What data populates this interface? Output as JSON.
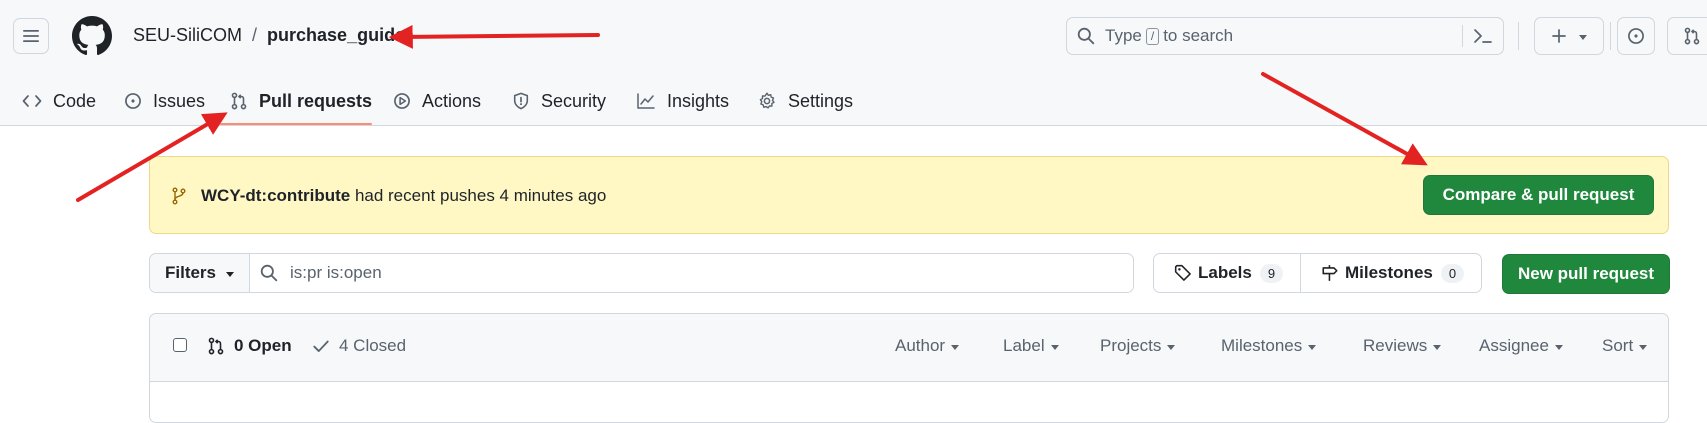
{
  "header": {
    "owner": "SEU-SiliCOM",
    "separator": "/",
    "repo": "purchase_guide",
    "search": {
      "prefix": "Type",
      "key": "/",
      "suffix": "to search"
    }
  },
  "tabs": [
    {
      "label": "Code",
      "icon": "code-icon"
    },
    {
      "label": "Issues",
      "icon": "issue-opened-icon"
    },
    {
      "label": "Pull requests",
      "icon": "git-pull-request-icon",
      "active": true
    },
    {
      "label": "Actions",
      "icon": "play-icon"
    },
    {
      "label": "Security",
      "icon": "shield-icon"
    },
    {
      "label": "Insights",
      "icon": "graph-icon"
    },
    {
      "label": "Settings",
      "icon": "gear-icon"
    }
  ],
  "flash": {
    "branch": "WCY-dt:contribute",
    "message": "had recent pushes 4 minutes ago",
    "compare_label": "Compare & pull request"
  },
  "filters": {
    "filters_label": "Filters",
    "query": "is:pr is:open",
    "labels_label": "Labels",
    "labels_count": "9",
    "milestones_label": "Milestones",
    "milestones_count": "0",
    "new_pr_label": "New pull request"
  },
  "list": {
    "open_label": "0 Open",
    "closed_label": "4 Closed",
    "dropdowns": [
      "Author",
      "Label",
      "Projects",
      "Milestones",
      "Reviews",
      "Assignee",
      "Sort"
    ]
  },
  "colors": {
    "accent_green": "#1f883d",
    "flash_bg": "#fff8c5",
    "tab_underline": "#fd8c73",
    "annotation_arrow": "#e32222"
  }
}
